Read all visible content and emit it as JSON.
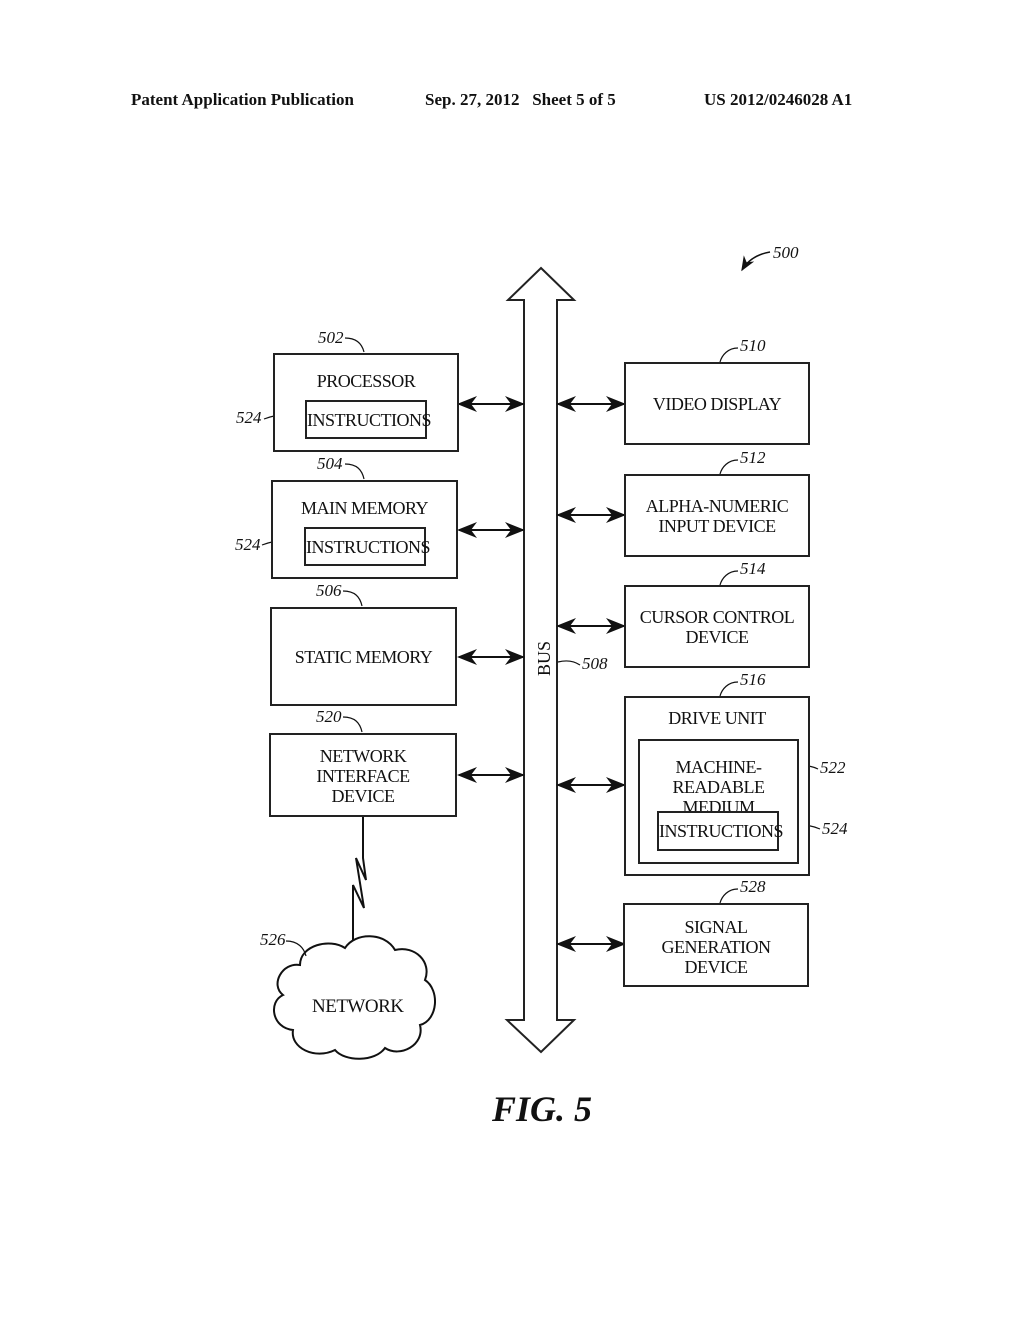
{
  "header": {
    "publication": "Patent Application Publication",
    "date_sheet": "Sep. 27, 2012   Sheet 5 of 5",
    "number": "US 2012/0246028 A1"
  },
  "figure": {
    "ref": "500",
    "caption": "FIG. 5",
    "bus": {
      "label": "BUS",
      "ref": "508"
    },
    "left_blocks": [
      {
        "ref": "502",
        "label": "PROCESSOR",
        "inner": {
          "label": "INSTRUCTIONS",
          "ref": "524"
        }
      },
      {
        "ref": "504",
        "label": "MAIN MEMORY",
        "inner": {
          "label": "INSTRUCTIONS",
          "ref": "524"
        }
      },
      {
        "ref": "506",
        "label": "STATIC MEMORY"
      },
      {
        "ref": "520",
        "label": "NETWORK\nINTERFACE\nDEVICE"
      }
    ],
    "right_blocks": [
      {
        "ref": "510",
        "label": "VIDEO DISPLAY"
      },
      {
        "ref": "512",
        "label": "ALPHA-NUMERIC\nINPUT DEVICE"
      },
      {
        "ref": "514",
        "label": "CURSOR CONTROL\nDEVICE"
      },
      {
        "ref": "516",
        "label": "DRIVE UNIT",
        "medium": {
          "ref": "522",
          "label": "MACHINE-READABLE\nMEDIUM"
        },
        "inner": {
          "label": "INSTRUCTIONS",
          "ref": "524"
        }
      },
      {
        "ref": "528",
        "label": "SIGNAL\nGENERATION\nDEVICE"
      }
    ],
    "network": {
      "ref": "526",
      "label": "NETWORK"
    }
  }
}
